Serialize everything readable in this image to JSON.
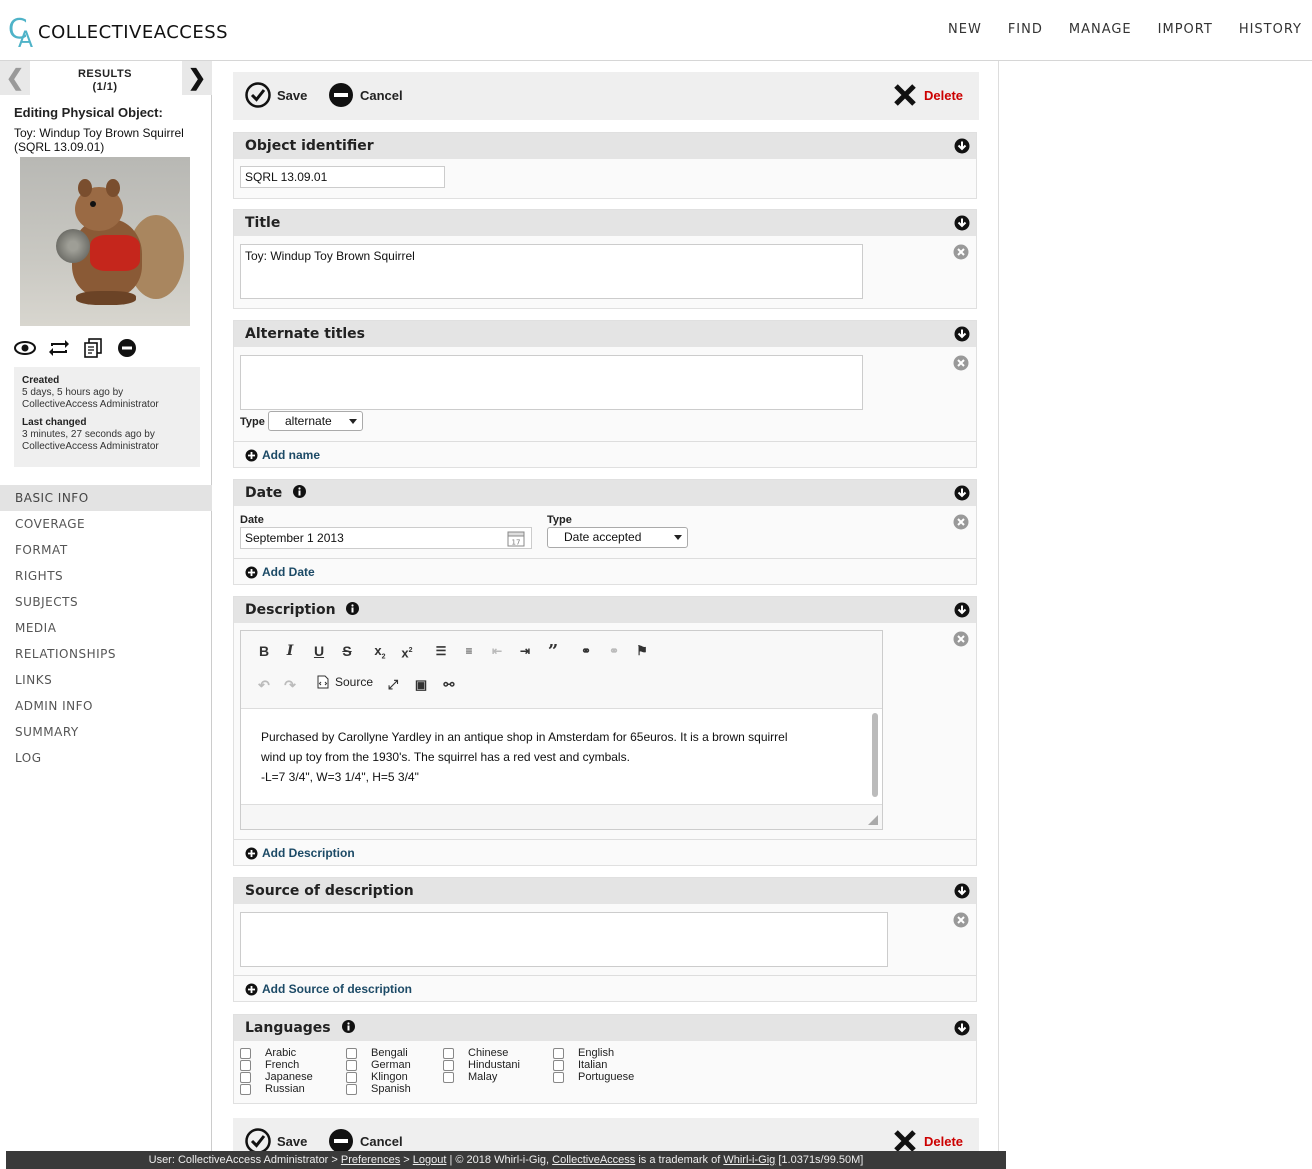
{
  "logo": {
    "c": "C",
    "a": "A",
    "word": "COLLECTIVEACCESS"
  },
  "topnav": [
    "NEW",
    "FIND",
    "MANAGE",
    "IMPORT",
    "HISTORY"
  ],
  "results": {
    "label": "RESULTS",
    "count": "(1/1)"
  },
  "edit": {
    "heading": "Editing Physical Object:",
    "title": "Toy: Windup Toy Brown Squirrel (SQRL 13.09.01)"
  },
  "info": {
    "created_label": "Created",
    "created_value": "5 days, 5 hours ago by CollectiveAccess Administrator",
    "changed_label": "Last changed",
    "changed_value": "3 minutes, 27 seconds ago by CollectiveAccess Administrator"
  },
  "sidenav": [
    "BASIC INFO",
    "COVERAGE",
    "FORMAT",
    "RIGHTS",
    "SUBJECTS",
    "MEDIA",
    "RELATIONSHIPS",
    "LINKS",
    "ADMIN INFO",
    "SUMMARY",
    "LOG"
  ],
  "actions": {
    "save": "Save",
    "cancel": "Cancel",
    "delete": "Delete"
  },
  "bundles": {
    "identifier": {
      "label": "Object identifier",
      "value": "SQRL 13.09.01"
    },
    "title": {
      "label": "Title",
      "value": "Toy: Windup Toy Brown Squirrel"
    },
    "alternate": {
      "label": "Alternate titles",
      "value": "",
      "type_label": "Type",
      "type_value": "alternate",
      "add": "Add name"
    },
    "date": {
      "label": "Date",
      "date_label": "Date",
      "date_value": "September 1 2013",
      "type_label": "Type",
      "type_value": "Date accepted",
      "add": "Add Date"
    },
    "description": {
      "label": "Description",
      "source_btn": "Source",
      "text_line1": "Purchased by Carollyne Yardley in an antique shop in Amsterdam for 65euros.  It is a brown squirrel",
      "text_line2": "wind up toy from the 1930's. The squirrel has a red vest and cymbals.",
      "text_line3": "-L=7 3/4\", W=3 1/4\", H=5 3/4\"",
      "add": "Add Description"
    },
    "source": {
      "label": "Source of description",
      "value": "",
      "add": "Add Source of description"
    },
    "languages": {
      "label": "Languages",
      "items": [
        "Arabic",
        "French",
        "Japanese",
        "Russian",
        "Bengali",
        "German",
        "Klingon",
        "Spanish",
        "Chinese",
        "Hindustani",
        "Malay",
        "English",
        "Italian",
        "Portuguese"
      ]
    }
  },
  "footer": {
    "user": "User: CollectiveAccess Administrator >",
    "prefs": "Preferences",
    "sep1": ">",
    "logout": "Logout",
    "sep2": "|  © 2018 Whirl-i-Gig,",
    "ca": "CollectiveAccess",
    "mid": "is a trademark of",
    "wig": "Whirl-i-Gig",
    "stats": "[1.0371s/99.50M]"
  }
}
